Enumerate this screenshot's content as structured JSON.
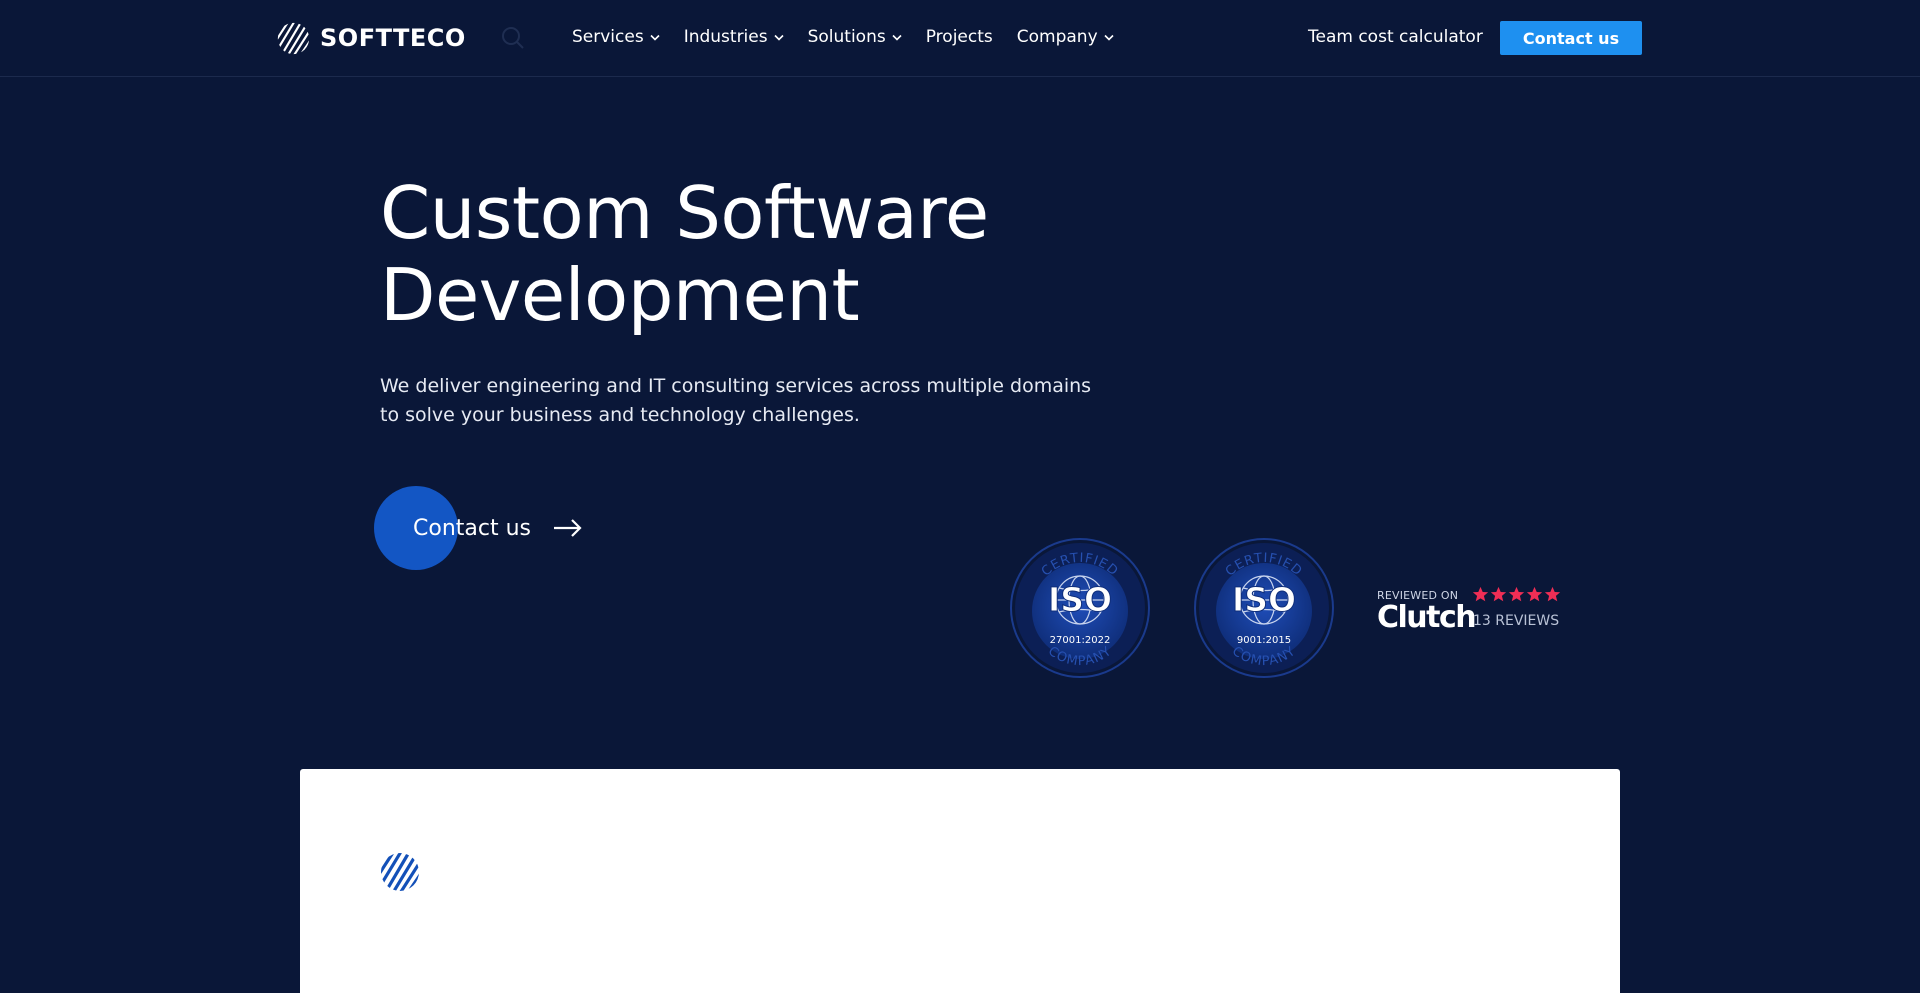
{
  "header": {
    "logo_text": "SOFTTECO",
    "nav": [
      {
        "label": "Services",
        "has_dropdown": true
      },
      {
        "label": "Industries",
        "has_dropdown": true
      },
      {
        "label": "Solutions",
        "has_dropdown": true
      },
      {
        "label": "Projects",
        "has_dropdown": false
      },
      {
        "label": "Company",
        "has_dropdown": true
      }
    ],
    "calculator_link": "Team cost calculator",
    "contact_button": "Contact us",
    "icons": {
      "search": "search-icon",
      "dropdown": "chevron-down-icon"
    }
  },
  "hero": {
    "title_line1": "Custom Software",
    "title_line2": "Development",
    "subtitle_line1": "We deliver engineering and IT consulting services across multiple domains",
    "subtitle_line2": "to solve your business and technology challenges.",
    "cta_label": "Contact us"
  },
  "badges": {
    "iso": [
      {
        "top_text": "CERTIFIED",
        "mark": "ISO",
        "standard": "27001:2022",
        "bottom_text": "COMPANY"
      },
      {
        "top_text": "CERTIFIED",
        "mark": "ISO",
        "standard": "9001:2015",
        "bottom_text": "COMPANY"
      }
    ],
    "clutch": {
      "reviewed_on": "REVIEWED ON",
      "brand": "Clutch",
      "rating_stars": 5,
      "reviews": "13 REVIEWS"
    }
  },
  "colors": {
    "background": "#0a1738",
    "accent": "#1e90f0",
    "cta_circle": "#1356c4",
    "star": "#ef2e55",
    "panel": "#ffffff"
  }
}
